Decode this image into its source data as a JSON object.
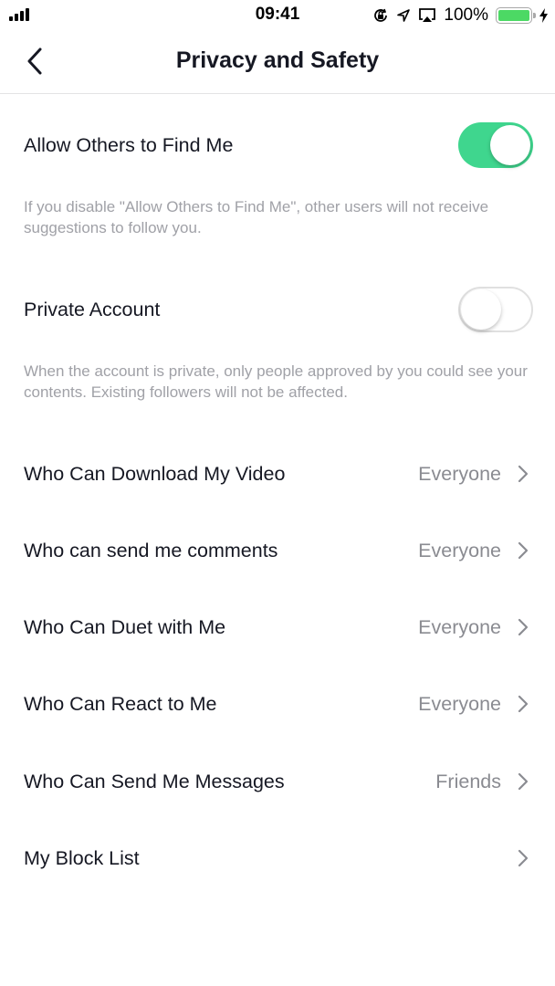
{
  "status_bar": {
    "time": "09:41",
    "battery_percent": "100%",
    "battery_level": 1.0,
    "icons": [
      "signal-icon",
      "orientation-lock-icon",
      "location-icon",
      "airplay-icon",
      "battery-icon",
      "charging-icon"
    ]
  },
  "header": {
    "title": "Privacy and Safety",
    "back_icon": "chevron-left-icon"
  },
  "toggles": [
    {
      "label": "Allow Others to Find Me",
      "state": "on",
      "description": "If you disable \"Allow Others to Find Me\", other users will not receive suggestions to follow you."
    },
    {
      "label": "Private Account",
      "state": "off",
      "description": "When the account is private, only people approved by you could see your contents. Existing followers will not be affected."
    }
  ],
  "settings": [
    {
      "label": "Who Can Download My Video",
      "value": "Everyone"
    },
    {
      "label": "Who can send me comments",
      "value": "Everyone"
    },
    {
      "label": "Who Can Duet with Me",
      "value": "Everyone"
    },
    {
      "label": "Who Can React to Me",
      "value": "Everyone"
    },
    {
      "label": "Who Can Send Me Messages",
      "value": "Friends"
    },
    {
      "label": "My Block List",
      "value": ""
    }
  ],
  "colors": {
    "toggle_on": "#3fd68e",
    "battery": "#4cd964",
    "text_primary": "#161823",
    "text_secondary": "#a0a1a7",
    "value_text": "#8a8b91"
  }
}
